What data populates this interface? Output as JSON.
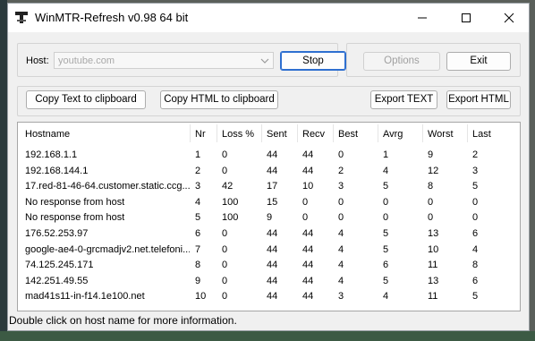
{
  "window": {
    "title": "WinMTR-Refresh v0.98 64 bit",
    "icons": {
      "app": "network-tool-icon",
      "minimize": "minimize-icon",
      "maximize": "maximize-icon",
      "close": "close-icon"
    }
  },
  "host": {
    "label": "Host:",
    "value": "youtube.com",
    "combo_icon": "chevron-down-icon"
  },
  "buttons": {
    "stop": "Stop",
    "options": "Options",
    "exit": "Exit",
    "copy_text": "Copy Text to clipboard",
    "copy_html": "Copy HTML to clipboard",
    "export_text": "Export TEXT",
    "export_html": "Export HTML"
  },
  "table": {
    "columns": [
      "Hostname",
      "Nr",
      "Loss %",
      "Sent",
      "Recv",
      "Best",
      "Avrg",
      "Worst",
      "Last"
    ],
    "rows": [
      [
        "192.168.1.1",
        "1",
        "0",
        "44",
        "44",
        "0",
        "1",
        "9",
        "2"
      ],
      [
        "192.168.144.1",
        "2",
        "0",
        "44",
        "44",
        "2",
        "4",
        "12",
        "3"
      ],
      [
        "17.red-81-46-64.customer.static.ccg...",
        "3",
        "42",
        "17",
        "10",
        "3",
        "5",
        "8",
        "5"
      ],
      [
        "No response from host",
        "4",
        "100",
        "15",
        "0",
        "0",
        "0",
        "0",
        "0"
      ],
      [
        "No response from host",
        "5",
        "100",
        "9",
        "0",
        "0",
        "0",
        "0",
        "0"
      ],
      [
        "176.52.253.97",
        "6",
        "0",
        "44",
        "44",
        "4",
        "5",
        "13",
        "6"
      ],
      [
        "google-ae4-0-grcmadjv2.net.telefoni...",
        "7",
        "0",
        "44",
        "44",
        "4",
        "5",
        "10",
        "4"
      ],
      [
        "74.125.245.171",
        "8",
        "0",
        "44",
        "44",
        "4",
        "6",
        "11",
        "8"
      ],
      [
        "142.251.49.55",
        "9",
        "0",
        "44",
        "44",
        "4",
        "5",
        "13",
        "6"
      ],
      [
        "mad41s11-in-f14.1e100.net",
        "10",
        "0",
        "44",
        "44",
        "3",
        "4",
        "11",
        "5"
      ]
    ]
  },
  "status": {
    "text": "Double click on host name for more information."
  },
  "colors": {
    "accent": "#2e6fd0",
    "window_bg": "#f0f0f0",
    "list_bg": "#ffffff"
  }
}
